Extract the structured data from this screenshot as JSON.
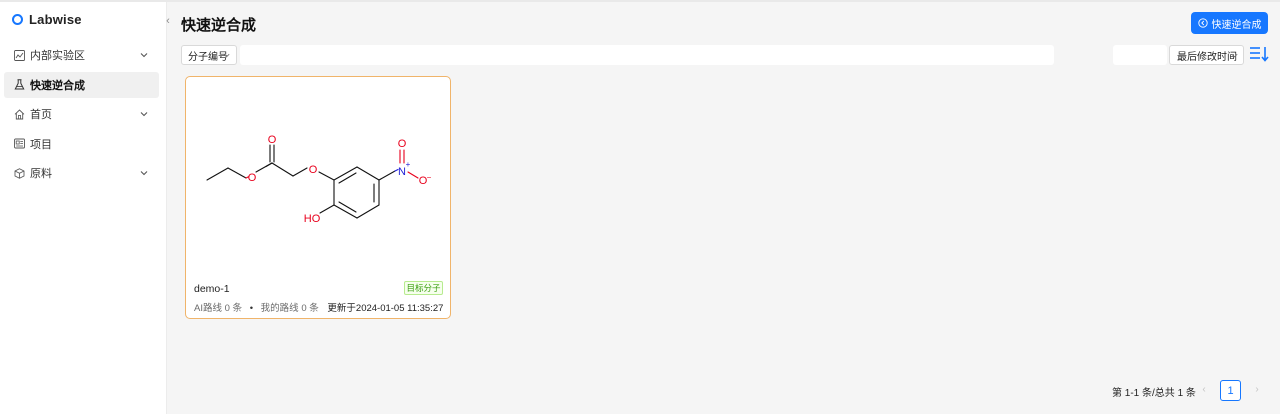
{
  "brand": {
    "name": "Labwise"
  },
  "sidebar": {
    "items": [
      {
        "label": "内部实验区",
        "icon": "lab-chart-icon",
        "expandable": true,
        "active": false
      },
      {
        "label": "快速逆合成",
        "icon": "flask-icon",
        "expandable": false,
        "active": true
      },
      {
        "label": "首页",
        "icon": "home-icon",
        "expandable": true,
        "active": false
      },
      {
        "label": "项目",
        "icon": "project-icon",
        "expandable": false,
        "active": false
      },
      {
        "label": "原料",
        "icon": "cube-icon",
        "expandable": true,
        "active": false
      }
    ]
  },
  "header": {
    "title": "快速逆合成",
    "primary_button": "快速逆合成"
  },
  "filters": {
    "field_select": "分子编号",
    "sort_select": "最后修改时间"
  },
  "cards": [
    {
      "name": "demo-1",
      "tag": "目标分子",
      "ai_routes_label": "AI路线",
      "ai_routes_count": "0 条",
      "my_routes_label": "我的路线",
      "my_routes_count": "0 条",
      "updated": "更新于2024-01-05 11:35:27",
      "molecule": {
        "atom_labels": {
          "o_carbonyl": "O",
          "o_ester": "O",
          "o_ether": "O",
          "oh": "HO",
          "n": "N",
          "n_charge": "+",
          "o_nitro_top": "O",
          "o_nitro_right": "O",
          "o_nitro_charge": "−"
        }
      }
    }
  ],
  "pagination": {
    "total_text": "第 1-1 条/总共 1 条",
    "current_page": "1",
    "prev": "‹",
    "next": "›"
  },
  "colors": {
    "accent": "#1677ff",
    "card_border": "#f0b46a",
    "tag_green": "#389e0d",
    "oxygen_red": "#e8001c",
    "nitrogen_blue": "#1f1fd6"
  }
}
